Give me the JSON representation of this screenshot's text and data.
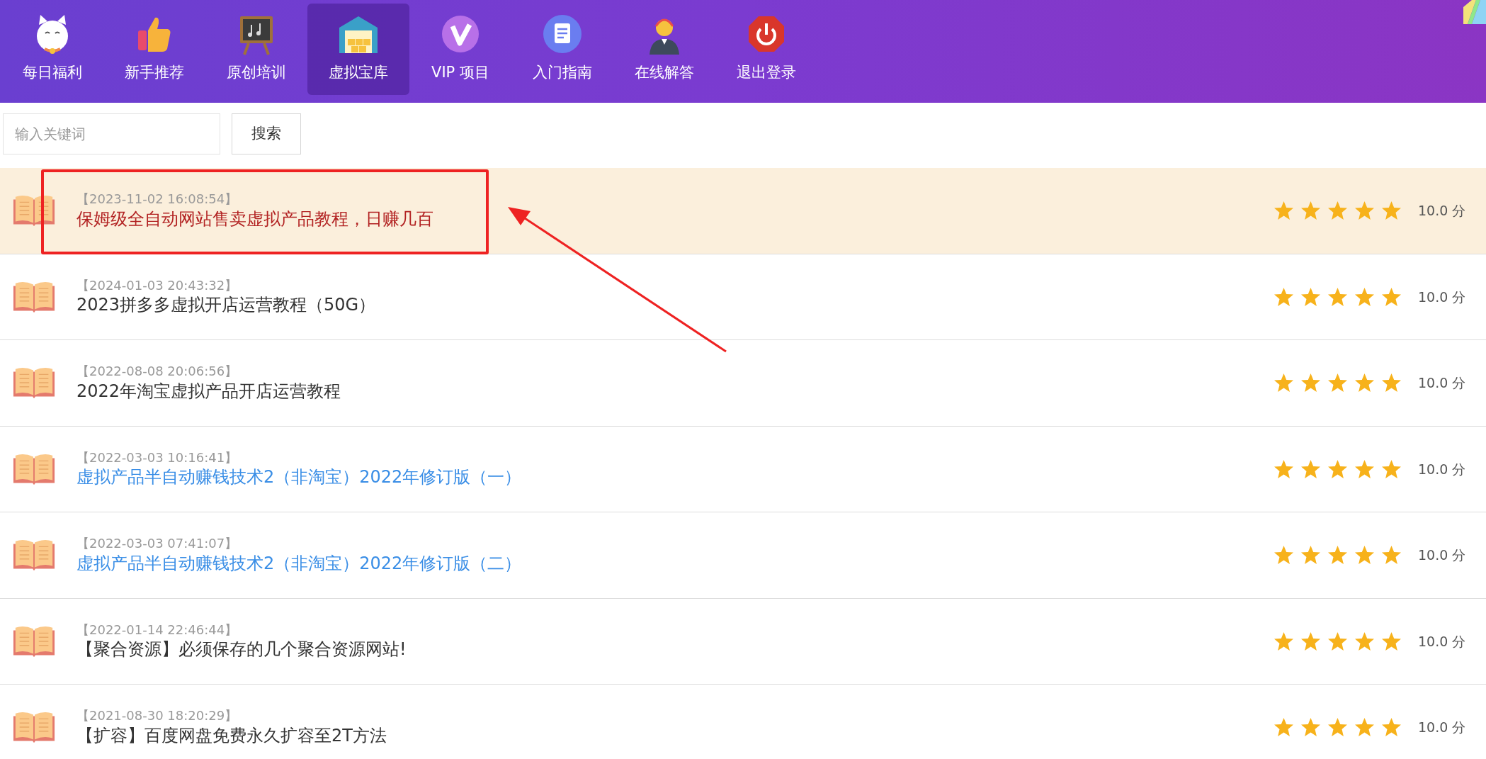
{
  "nav": [
    {
      "label": "每日福利",
      "selected": false
    },
    {
      "label": "新手推荐",
      "selected": false
    },
    {
      "label": "原创培训",
      "selected": false
    },
    {
      "label": "虚拟宝库",
      "selected": true
    },
    {
      "label": "VIP 项目",
      "selected": false
    },
    {
      "label": "入门指南",
      "selected": false
    },
    {
      "label": "在线解答",
      "selected": false
    },
    {
      "label": "退出登录",
      "selected": false
    }
  ],
  "search": {
    "placeholder": "输入关键词",
    "button": "搜索"
  },
  "items": [
    {
      "date": "【2023-11-02 16:08:54】",
      "title": "保姆级全自动网站售卖虚拟产品教程，日赚几百",
      "color": "#b22222",
      "highlighted": true,
      "annotated": true,
      "stars": 5,
      "score": "10.0 分"
    },
    {
      "date": "【2024-01-03 20:43:32】",
      "title": "2023拼多多虚拟开店运营教程（50G）",
      "color": "#333333",
      "highlighted": false,
      "annotated": false,
      "stars": 5,
      "score": "10.0 分"
    },
    {
      "date": "【2022-08-08 20:06:56】",
      "title": "2022年淘宝虚拟产品开店运营教程",
      "color": "#333333",
      "highlighted": false,
      "annotated": false,
      "stars": 5,
      "score": "10.0 分"
    },
    {
      "date": "【2022-03-03 10:16:41】",
      "title": "虚拟产品半自动赚钱技术2（非淘宝）2022年修订版（一）",
      "color": "#3a8ee6",
      "highlighted": false,
      "annotated": false,
      "stars": 5,
      "score": "10.0 分"
    },
    {
      "date": "【2022-03-03 07:41:07】",
      "title": "虚拟产品半自动赚钱技术2（非淘宝）2022年修订版（二）",
      "color": "#3a8ee6",
      "highlighted": false,
      "annotated": false,
      "stars": 5,
      "score": "10.0 分"
    },
    {
      "date": "【2022-01-14 22:46:44】",
      "title": "【聚合资源】必须保存的几个聚合资源网站!",
      "color": "#333333",
      "highlighted": false,
      "annotated": false,
      "stars": 5,
      "score": "10.0 分"
    },
    {
      "date": "【2021-08-30 18:20:29】",
      "title": "【扩容】百度网盘免费永久扩容至2T方法",
      "color": "#333333",
      "highlighted": false,
      "annotated": false,
      "stars": 5,
      "score": "10.0 分"
    }
  ]
}
